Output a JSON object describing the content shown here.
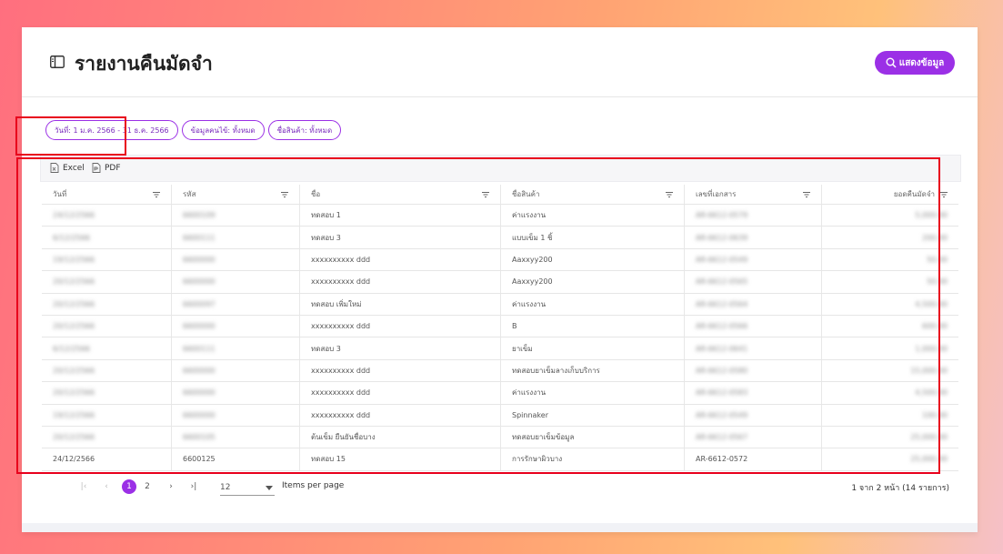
{
  "header": {
    "title": "รายงานคืนมัดจำ",
    "title_icon": "sidebar-toggle-icon",
    "show_button": {
      "label": "แสดงข้อมูล",
      "icon": "search-icon"
    }
  },
  "filters": {
    "chips": [
      "วันที่: 1 ม.ค. 2566 - 31 ธ.ค. 2566",
      "ข้อมูลคนไข้: ทั้งหมด",
      "ชื่อสินค้า: ทั้งหมด"
    ]
  },
  "toolbar": {
    "excel_label": "Excel",
    "pdf_label": "PDF"
  },
  "table": {
    "columns": [
      "วันที่",
      "รหัส",
      "ชื่อ",
      "ชื่อสินค้า",
      "เลขที่เอกสาร",
      "ยอดคืนมัดจำ"
    ],
    "rows": [
      [
        "24/12/2566",
        "6600109",
        "ทดสอบ 1",
        "ค่าแรงงาน",
        "AR-6612-0579",
        "5,000.00"
      ],
      [
        "6/12/2566",
        "6600111",
        "ทดสอบ 3",
        "แบบเข็ม 1 ชิ้",
        "AR-6612-0639",
        "200.00"
      ],
      [
        "19/12/2566",
        "6600000",
        "xxxxxxxxxx ddd",
        "Aaxxyy200",
        "AR-6612-0549",
        "50.00"
      ],
      [
        "20/12/2566",
        "6600000",
        "xxxxxxxxxx ddd",
        "Aaxxyy200",
        "AR-6612-0565",
        "50.00"
      ],
      [
        "20/12/2566",
        "6600097",
        "ทดสอบ เพิ่มใหม่",
        "ค่าแรงงาน",
        "AR-6612-0564",
        "4,500.00"
      ],
      [
        "20/12/2566",
        "6600000",
        "xxxxxxxxxx ddd",
        "B",
        "AR-6612-0566",
        "600.00"
      ],
      [
        "6/12/2566",
        "6600111",
        "ทดสอบ 3",
        "ยาเข็ม",
        "AR-6612-0641",
        "1,000.00"
      ],
      [
        "20/12/2566",
        "6600000",
        "xxxxxxxxxx ddd",
        "ทดสอบยาเข็มลางเก็บบริการ",
        "AR-6612-0580",
        "15,000.00"
      ],
      [
        "20/12/2566",
        "6600000",
        "xxxxxxxxxx ddd",
        "ค่าแรงงาน",
        "AR-6612-0583",
        "4,500.00"
      ],
      [
        "19/12/2566",
        "6600000",
        "xxxxxxxxxx ddd",
        "Spinnaker",
        "AR-6612-0549",
        "100.00"
      ],
      [
        "20/12/2566",
        "6600105",
        "ต้นเข็ม ยืนยันชื่อบาง",
        "ทดสอบยาเข็มข้อมูล",
        "AR-6612-0567",
        "25,000.00"
      ],
      [
        "24/12/2566",
        "6600125",
        "ทดสอบ 15",
        "การรักษาผิวบาง",
        "AR-6612-0572",
        "25,000.00"
      ]
    ]
  },
  "pagination": {
    "pages": [
      "1",
      "2"
    ],
    "current_page": "1",
    "first_label": "|‹",
    "prev_label": "‹",
    "next_label": "›",
    "last_label": "›|",
    "page_size": "12",
    "items_per_page_label": "Items per page",
    "summary": "1 จาก 2 หน้า (14 รายการ)"
  },
  "colors": {
    "accent": "#9b30e6",
    "highlight_box": "#e8001c"
  }
}
